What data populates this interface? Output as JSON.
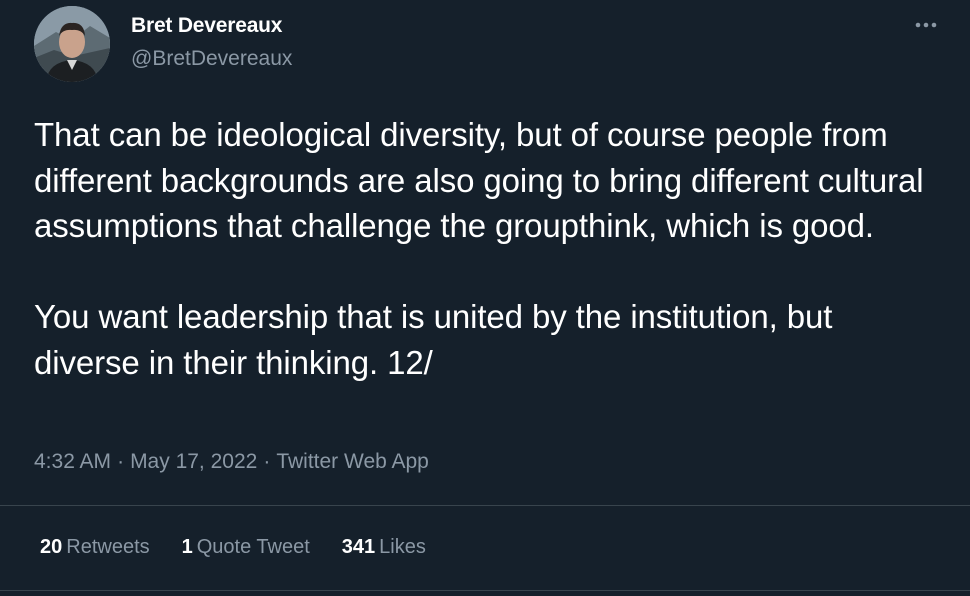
{
  "author": {
    "name": "Bret Devereaux",
    "handle": "@BretDevereaux"
  },
  "tweet": {
    "paragraphs": [
      "That can be ideological diversity, but of course people from different backgrounds are also going to bring different cultural assumptions that challenge the groupthink, which is good.",
      "You want leadership that is united by the institution, but diverse in their thinking.  12/"
    ],
    "time": "4:32 AM",
    "date": "May 17, 2022",
    "source": "Twitter Web App",
    "separator": "·"
  },
  "stats": {
    "retweets_count": "20",
    "retweets_label": "Retweets",
    "quotes_count": "1",
    "quotes_label": "Quote Tweet",
    "likes_count": "341",
    "likes_label": "Likes"
  },
  "icons": {
    "more": "more-horizontal-icon"
  },
  "colors": {
    "background": "#15202b",
    "primary_text": "#ffffff",
    "secondary_text": "#8b98a5",
    "divider": "#38444d"
  }
}
